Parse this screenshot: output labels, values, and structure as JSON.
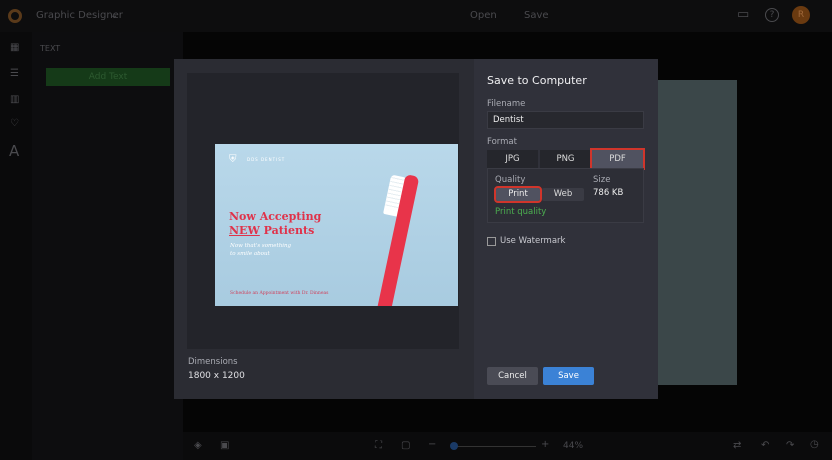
{
  "topbar": {
    "app_title": "Graphic Designer",
    "open_label": "Open",
    "save_label": "Save",
    "avatar_initial": "R"
  },
  "sidebar": {
    "panel_title": "TEXT",
    "add_text_label": "Add Text"
  },
  "dialog": {
    "title": "Save to Computer",
    "filename_label": "Filename",
    "filename_value": "Dentist",
    "format_label": "Format",
    "formats": [
      "JPG",
      "PNG",
      "PDF"
    ],
    "selected_format": "PDF",
    "quality_label": "Quality",
    "qualities": [
      "Print",
      "Web"
    ],
    "selected_quality": "Print",
    "quality_note": "Print quality",
    "size_label": "Size",
    "size_value": "786 KB",
    "watermark_label": "Use Watermark",
    "watermark_checked": false,
    "dimensions_label": "Dimensions",
    "dimensions_value": "1800 x 1200",
    "cancel_label": "Cancel",
    "save_label": "Save"
  },
  "preview_card": {
    "logo_text": "DDS DENTIST",
    "headline_1": "Now Accepting",
    "headline_2a": "NEW",
    "headline_2b": " Patients",
    "subtitle_1": "Now that's something",
    "subtitle_2": "to smile about",
    "footer": "Schedule an Appointment with Dr. Dinneas"
  },
  "bottombar": {
    "zoom_level": "44%",
    "zoom_fraction": 0.1
  },
  "colors": {
    "accent": "#3b82d6",
    "highlight": "#d0352b",
    "success": "#4caf50",
    "brand_red": "#e0324a"
  }
}
